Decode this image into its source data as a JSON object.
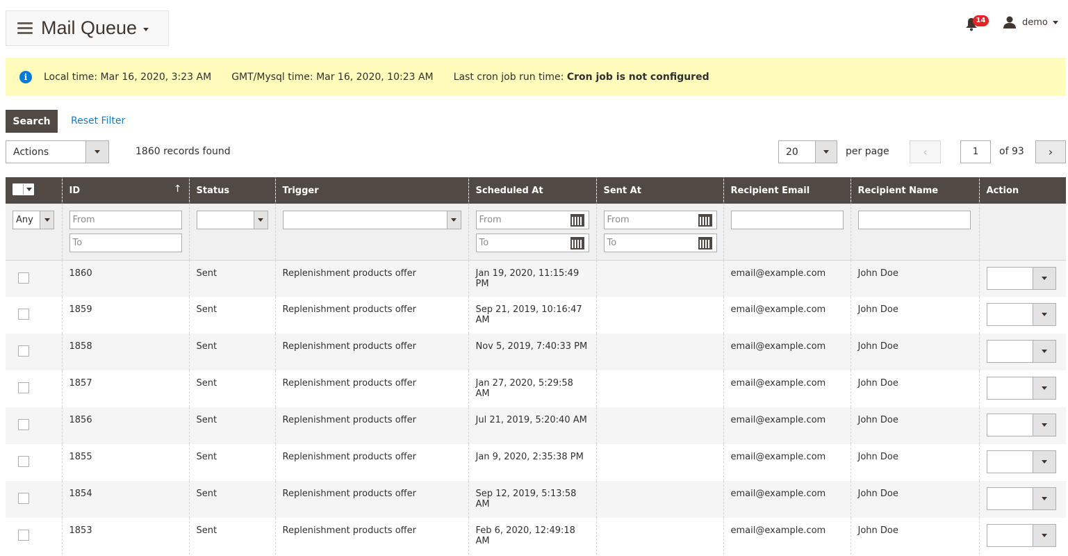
{
  "header": {
    "title": "Mail Queue",
    "notifications_count": "14",
    "user_name": "demo"
  },
  "info_bar": {
    "local_time": "Local time: Mar 16, 2020, 3:23 AM",
    "gmt_time": "GMT/Mysql time: Mar 16, 2020, 10:23 AM",
    "cron_label": "Last cron job run time: ",
    "cron_value": "Cron job is not configured"
  },
  "toolbar": {
    "search_label": "Search",
    "reset_label": "Reset Filter",
    "actions_label": "Actions",
    "records_found": "1860 records found",
    "per_page_value": "20",
    "per_page_label": "per page",
    "current_page": "1",
    "total_pages_label": "of 93"
  },
  "columns": {
    "id": "ID",
    "status": "Status",
    "trigger": "Trigger",
    "scheduled_at": "Scheduled At",
    "sent_at": "Sent At",
    "recipient_email": "Recipient Email",
    "recipient_name": "Recipient Name",
    "action": "Action"
  },
  "filters": {
    "mass_select": "Any",
    "id_from": "From",
    "id_to": "To",
    "status": "",
    "trigger": "",
    "scheduled_from": "From",
    "scheduled_to": "To",
    "sent_from": "From",
    "sent_to": "To",
    "recipient_email": "",
    "recipient_name": ""
  },
  "rows": [
    {
      "id": "1860",
      "status": "Sent",
      "trigger": "Replenishment products offer",
      "scheduled_at": "Jan 19, 2020, 11:15:49 PM",
      "sent_at": "",
      "email": "email@example.com",
      "name": "John Doe"
    },
    {
      "id": "1859",
      "status": "Sent",
      "trigger": "Replenishment products offer",
      "scheduled_at": "Sep 21, 2019, 10:16:47 AM",
      "sent_at": "",
      "email": "email@example.com",
      "name": "John Doe"
    },
    {
      "id": "1858",
      "status": "Sent",
      "trigger": "Replenishment products offer",
      "scheduled_at": "Nov 5, 2019, 7:40:33 PM",
      "sent_at": "",
      "email": "email@example.com",
      "name": "John Doe"
    },
    {
      "id": "1857",
      "status": "Sent",
      "trigger": "Replenishment products offer",
      "scheduled_at": "Jan 27, 2020, 5:29:58 AM",
      "sent_at": "",
      "email": "email@example.com",
      "name": "John Doe"
    },
    {
      "id": "1856",
      "status": "Sent",
      "trigger": "Replenishment products offer",
      "scheduled_at": "Jul 21, 2019, 5:20:40 AM",
      "sent_at": "",
      "email": "email@example.com",
      "name": "John Doe"
    },
    {
      "id": "1855",
      "status": "Sent",
      "trigger": "Replenishment products offer",
      "scheduled_at": "Jan 9, 2020, 2:35:38 PM",
      "sent_at": "",
      "email": "email@example.com",
      "name": "John Doe"
    },
    {
      "id": "1854",
      "status": "Sent",
      "trigger": "Replenishment products offer",
      "scheduled_at": "Sep 12, 2019, 5:13:58 AM",
      "sent_at": "",
      "email": "email@example.com",
      "name": "John Doe"
    },
    {
      "id": "1853",
      "status": "Sent",
      "trigger": "Replenishment products offer",
      "scheduled_at": "Feb 6, 2020, 12:49:18 AM",
      "sent_at": "",
      "email": "email@example.com",
      "name": "John Doe"
    }
  ],
  "colors": {
    "header_bg": "#514943",
    "info_bg": "#fffbbb",
    "link": "#1979c3",
    "badge": "#e22626"
  }
}
